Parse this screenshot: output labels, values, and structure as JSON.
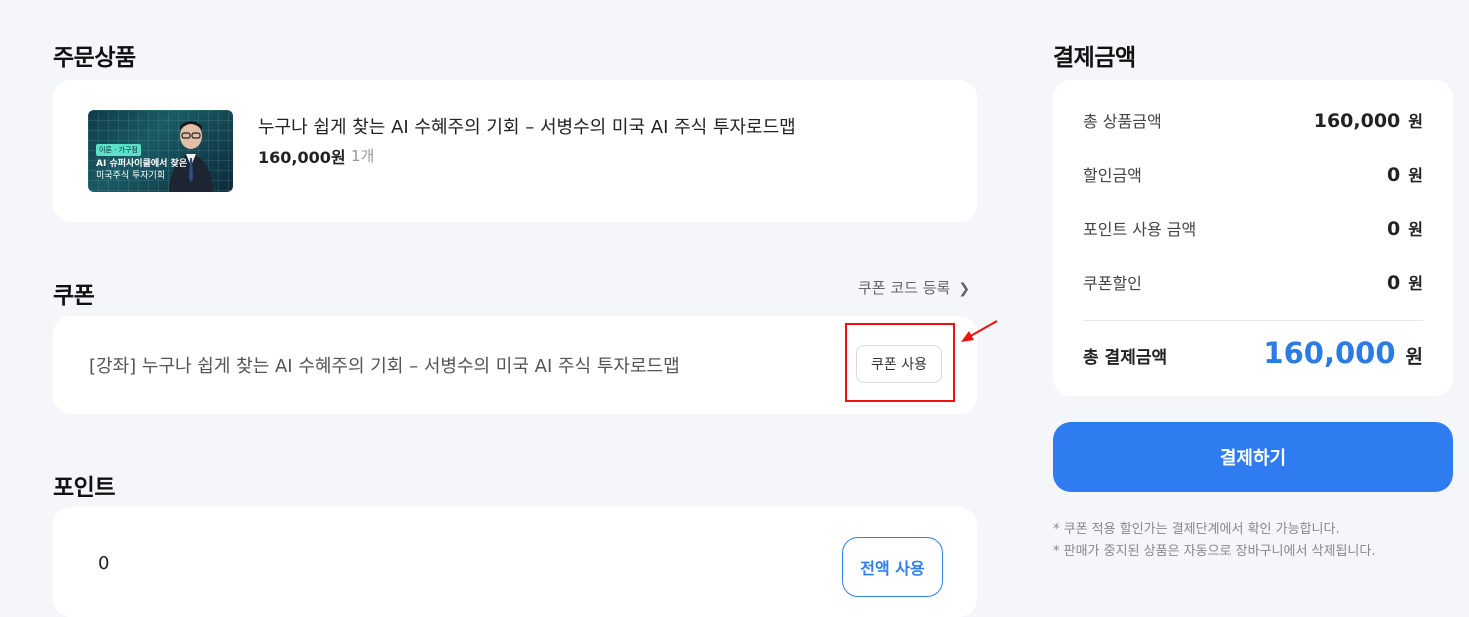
{
  "order": {
    "title": "주문상품",
    "thumb_badge": "이론 · 가구점",
    "thumb_line1": "AI 슈퍼사이클에서 찾은",
    "thumb_line2": "미국주식 투자기회",
    "product_name": "누구나 쉽게 찾는 AI 수혜주의 기회 – 서병수의 미국 AI 주식 투자로드맵",
    "price": "160,000원",
    "quantity": "1개"
  },
  "coupon": {
    "title": "쿠폰",
    "register_link": "쿠폰 코드 등록",
    "item_text": "[강좌] 누구나 쉽게 찾는 AI 수혜주의 기회 – 서병수의 미국 AI 주식 투자로드맵",
    "use_button": "쿠폰 사용"
  },
  "point": {
    "title": "포인트",
    "value": "0",
    "use_all_button": "전액 사용"
  },
  "summary": {
    "title": "결제금액",
    "rows": [
      {
        "label": "총 상품금액",
        "value": "160,000",
        "unit": "원"
      },
      {
        "label": "할인금액",
        "value": "0",
        "unit": "원"
      },
      {
        "label": "포인트 사용 금액",
        "value": "0",
        "unit": "원"
      },
      {
        "label": "쿠폰할인",
        "value": "0",
        "unit": "원"
      }
    ],
    "total_label": "총 결제금액",
    "total_value": "160,000",
    "total_unit": "원",
    "pay_button": "결제하기",
    "notes": [
      "* 쿠폰 적용 할인가는 결제단계에서 확인 가능합니다.",
      "* 판매가 중지된 상품은 자동으로 장바구니에서 삭제됩니다."
    ]
  },
  "colors": {
    "accent": "#2f7bf0",
    "highlight_box": "#ee1111",
    "background": "#f4f6f9"
  }
}
